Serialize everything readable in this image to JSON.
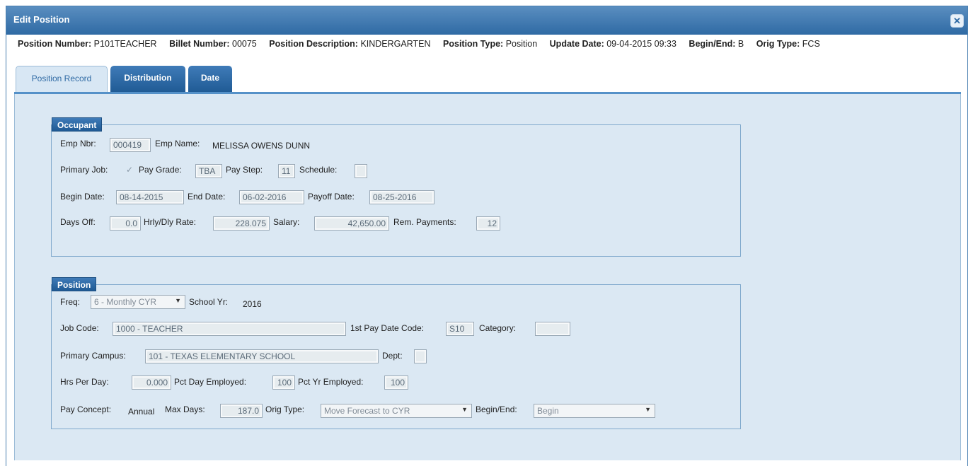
{
  "window": {
    "title": "Edit Position",
    "close_icon": "close-icon"
  },
  "info": [
    {
      "label": "Position Number:",
      "value": "P101TEACHER"
    },
    {
      "label": "Billet Number:",
      "value": "00075"
    },
    {
      "label": "Position Description:",
      "value": "KINDERGARTEN"
    },
    {
      "label": "Position Type:",
      "value": "Position"
    },
    {
      "label": "Update Date:",
      "value": "09-04-2015 09:33"
    },
    {
      "label": "Begin/End:",
      "value": "B"
    },
    {
      "label": "Orig Type:",
      "value": "FCS"
    }
  ],
  "tabs": [
    {
      "label": "Position Record",
      "active": true
    },
    {
      "label": "Distribution",
      "active": false
    },
    {
      "label": "Date",
      "active": false
    }
  ],
  "occupant": {
    "legend": "Occupant",
    "emp_nbr_label": "Emp Nbr:",
    "emp_nbr": "000419",
    "emp_name_label": "Emp Name:",
    "emp_name": "MELISSA OWENS DUNN",
    "primary_job_label": "Primary Job:",
    "primary_job_check": "✓",
    "pay_grade_label": "Pay Grade:",
    "pay_grade": "TBA",
    "pay_step_label": "Pay Step:",
    "pay_step": "11",
    "schedule_label": "Schedule:",
    "schedule": "",
    "begin_date_label": "Begin Date:",
    "begin_date": "08-14-2015",
    "end_date_label": "End Date:",
    "end_date": "06-02-2016",
    "payoff_date_label": "Payoff Date:",
    "payoff_date": "08-25-2016",
    "days_off_label": "Days Off:",
    "days_off": "0.0",
    "rate_label": "Hrly/Dly Rate:",
    "rate": "228.075",
    "salary_label": "Salary:",
    "salary": "42,650.00",
    "rem_payments_label": "Rem. Payments:",
    "rem_payments": "12"
  },
  "position": {
    "legend": "Position",
    "freq_label": "Freq:",
    "freq": "6 - Monthly CYR",
    "school_yr_label": "School Yr:",
    "school_yr": "2016",
    "job_code_label": "Job Code:",
    "job_code": "1000 - TEACHER",
    "first_pay_label": "1st Pay Date Code:",
    "first_pay": "S10",
    "category_label": "Category:",
    "category": "",
    "campus_label": "Primary Campus:",
    "campus": "101 - TEXAS ELEMENTARY SCHOOL",
    "dept_label": "Dept:",
    "dept": "",
    "hrs_label": "Hrs Per Day:",
    "hrs": "0.000",
    "pct_day_label": "Pct Day Employed:",
    "pct_day": "100",
    "pct_yr_label": "Pct Yr Employed:",
    "pct_yr": "100",
    "pay_concept_label": "Pay Concept:",
    "pay_concept": "Annual",
    "max_days_label": "Max Days:",
    "max_days": "187.0",
    "orig_type_label": "Orig Type:",
    "orig_type": "Move Forecast to CYR",
    "begin_end_label": "Begin/End:",
    "begin_end": "Begin"
  }
}
